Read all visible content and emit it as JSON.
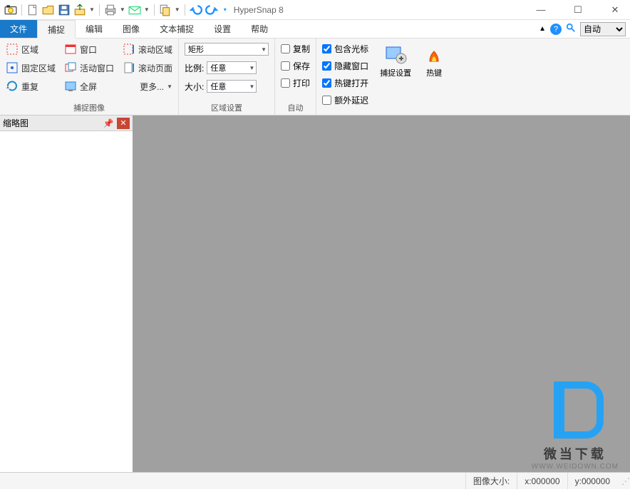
{
  "app_title": "HyperSnap 8",
  "menu": {
    "file": "文件",
    "tabs": [
      "捕捉",
      "编辑",
      "图像",
      "文本捕捉",
      "设置",
      "帮助"
    ],
    "zoom_select": "自动"
  },
  "ribbon": {
    "capture_image": {
      "label": "捕捉图像",
      "items": {
        "region": "区域",
        "window": "窗口",
        "fixed_region": "固定区域",
        "active_window": "活动窗口",
        "repeat": "重复",
        "fullscreen": "全屏",
        "scroll_region": "滚动区域",
        "scroll_page": "滚动页面",
        "more": "更多..."
      }
    },
    "region_settings": {
      "label": "区域设置",
      "shape": {
        "value": "矩形"
      },
      "ratio": {
        "label": "比例:",
        "value": "任意"
      },
      "size": {
        "label": "大小:",
        "value": "任意"
      }
    },
    "auto": {
      "label": "自动",
      "copy": "复制",
      "save": "保存",
      "print": "打印"
    },
    "options": {
      "include_cursor": "包含光标",
      "hide_window": "隐藏窗口",
      "hotkey_open": "热键打开",
      "extra_delay": "额外延迟"
    },
    "tools": {
      "capture_settings": "捕捉设置",
      "hotkeys": "热键"
    }
  },
  "panel": {
    "thumbnail": "缩略图"
  },
  "status": {
    "image_size_label": "图像大小:",
    "x": "x:000000",
    "y": "y:000000"
  },
  "watermark": {
    "brand": "微当下载",
    "url": "WWW.WEIDOWN.COM"
  }
}
